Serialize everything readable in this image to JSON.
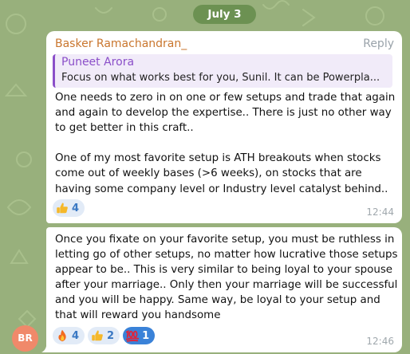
{
  "date_separator": "July 3",
  "messages": [
    {
      "sender": "Basker Ramachandran_",
      "reply_action": "Reply",
      "quote": {
        "author": "Puneet Arora",
        "text": "Focus on what works best for you, Sunil. It can be Powerpla..."
      },
      "text": "One needs to zero in on one or few setups and trade that again and again to develop the expertise.. There is just no other way to get better in this craft..\n\nOne of my most favorite setup is ATH breakouts when stocks come out of weekly bases (>6 weeks), on stocks that are having some company level or Industry level catalyst behind..",
      "reactions": [
        {
          "icon": "thumbs-up-icon",
          "count": "4"
        }
      ],
      "time": "12:44"
    },
    {
      "text": "Once you fixate on your favorite setup, you must be ruthless in letting go of other setups, no matter how lucrative those setups appear to be.. This is very similar to being loyal to your spouse after your marriage.. Only then your marriage will be successful and you will be happy. Same way, be loyal to your setup and that will reward you handsome",
      "reactions": [
        {
          "icon": "fire-icon",
          "count": "4"
        },
        {
          "icon": "thumbs-up-icon",
          "count": "2"
        },
        {
          "icon": "hundred-points-icon",
          "count": "1",
          "selected": true
        }
      ],
      "time": "12:46"
    }
  ],
  "avatar_initials": "BR",
  "colors": {
    "chat_background": "#98b07c",
    "sender_name": "#c9762e",
    "quote_accent": "#8b4fc9",
    "reaction_count": "#3a78c3",
    "avatar": "#f0896a"
  }
}
